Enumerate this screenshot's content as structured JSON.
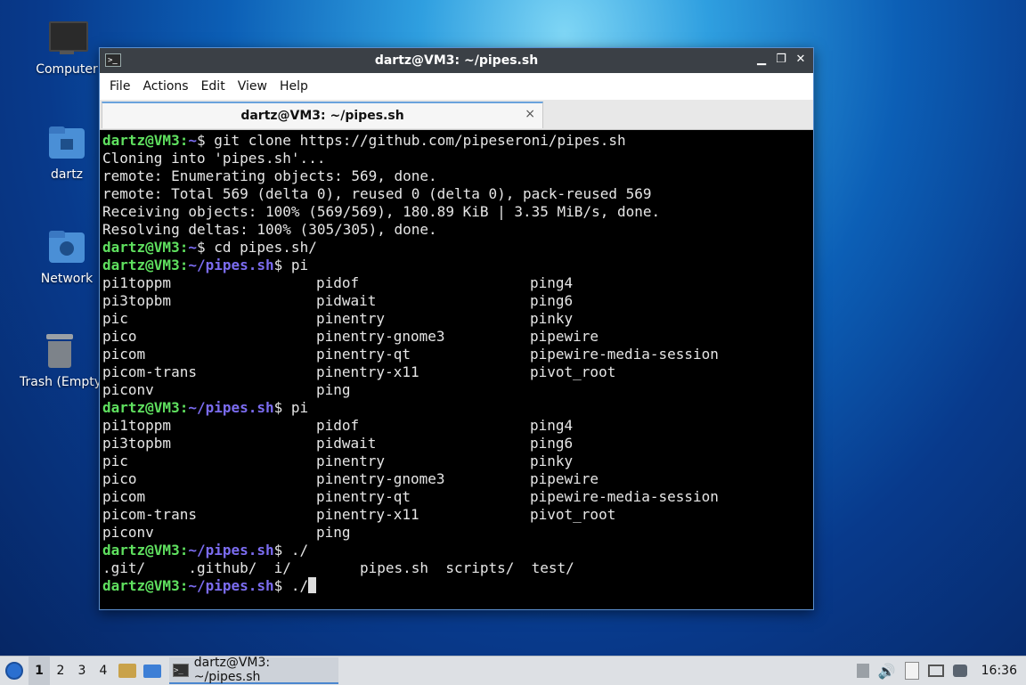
{
  "desktop": {
    "icons": [
      {
        "label": "Computer"
      },
      {
        "label": "dartz"
      },
      {
        "label": "Network"
      },
      {
        "label": "Trash (Empty)"
      }
    ]
  },
  "window": {
    "title": "dartz@VM3: ~/pipes.sh",
    "menu": [
      "File",
      "Actions",
      "Edit",
      "View",
      "Help"
    ],
    "tab_title": "dartz@VM3: ~/pipes.sh",
    "tab_close": "×",
    "controls": {
      "minimize": "▁",
      "restore": "❐",
      "close": "✕"
    }
  },
  "terminal": {
    "user_host": "dartz@VM3",
    "lines": [
      {
        "kind": "prompt",
        "path": "~",
        "cmd": "git clone https://github.com/pipeseroni/pipes.sh"
      },
      {
        "kind": "out",
        "text": "Cloning into 'pipes.sh'..."
      },
      {
        "kind": "out",
        "text": "remote: Enumerating objects: 569, done."
      },
      {
        "kind": "out",
        "text": "remote: Total 569 (delta 0), reused 0 (delta 0), pack-reused 569"
      },
      {
        "kind": "out",
        "text": "Receiving objects: 100% (569/569), 180.89 KiB | 3.35 MiB/s, done."
      },
      {
        "kind": "out",
        "text": "Resolving deltas: 100% (305/305), done."
      },
      {
        "kind": "prompt",
        "path": "~",
        "cmd": "cd pipes.sh/"
      },
      {
        "kind": "prompt",
        "path": "~/pipes.sh",
        "cmd": "pi"
      },
      {
        "kind": "cols",
        "cells": [
          "pi1toppm",
          "pidof",
          "ping4"
        ]
      },
      {
        "kind": "cols",
        "cells": [
          "pi3topbm",
          "pidwait",
          "ping6"
        ]
      },
      {
        "kind": "cols",
        "cells": [
          "pic",
          "pinentry",
          "pinky"
        ]
      },
      {
        "kind": "cols",
        "cells": [
          "pico",
          "pinentry-gnome3",
          "pipewire"
        ]
      },
      {
        "kind": "cols",
        "cells": [
          "picom",
          "pinentry-qt",
          "pipewire-media-session"
        ]
      },
      {
        "kind": "cols",
        "cells": [
          "picom-trans",
          "pinentry-x11",
          "pivot_root"
        ]
      },
      {
        "kind": "cols",
        "cells": [
          "piconv",
          "ping",
          ""
        ]
      },
      {
        "kind": "prompt",
        "path": "~/pipes.sh",
        "cmd": "pi"
      },
      {
        "kind": "cols",
        "cells": [
          "pi1toppm",
          "pidof",
          "ping4"
        ]
      },
      {
        "kind": "cols",
        "cells": [
          "pi3topbm",
          "pidwait",
          "ping6"
        ]
      },
      {
        "kind": "cols",
        "cells": [
          "pic",
          "pinentry",
          "pinky"
        ]
      },
      {
        "kind": "cols",
        "cells": [
          "pico",
          "pinentry-gnome3",
          "pipewire"
        ]
      },
      {
        "kind": "cols",
        "cells": [
          "picom",
          "pinentry-qt",
          "pipewire-media-session"
        ]
      },
      {
        "kind": "cols",
        "cells": [
          "picom-trans",
          "pinentry-x11",
          "pivot_root"
        ]
      },
      {
        "kind": "cols",
        "cells": [
          "piconv",
          "ping",
          ""
        ]
      },
      {
        "kind": "prompt",
        "path": "~/pipes.sh",
        "cmd": "./"
      },
      {
        "kind": "out",
        "text": ".git/     .github/  i/        pipes.sh  scripts/  test/"
      },
      {
        "kind": "prompt",
        "path": "~/pipes.sh",
        "cmd": "./",
        "cursor": true
      }
    ]
  },
  "panel": {
    "desktops": [
      "1",
      "2",
      "3",
      "4"
    ],
    "active_desktop": "1",
    "task_label": "dartz@VM3: ~/pipes.sh",
    "clock": "16:36"
  }
}
